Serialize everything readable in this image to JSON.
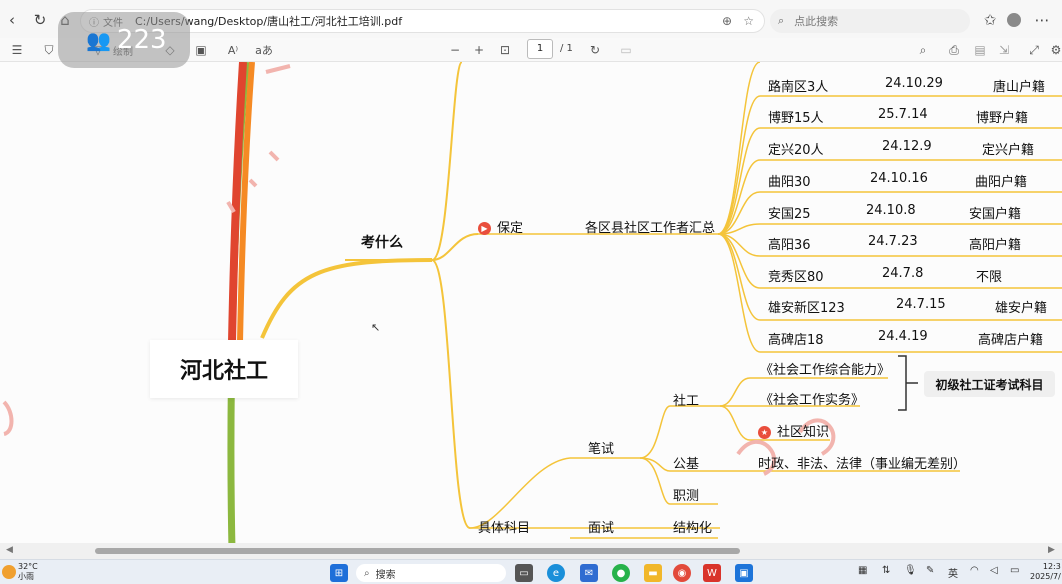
{
  "browser": {
    "file_label": "文件",
    "url": "C:/Users/wang/Desktop/唐山社工/河北社工培训.pdf",
    "search_placeholder": "点此搜索"
  },
  "pdf_toolbar": {
    "draw_label": "绘制",
    "page_current": "1",
    "page_total": "/ 1"
  },
  "overlay_badge": {
    "count": "223"
  },
  "mindmap": {
    "root": "河北社工",
    "branch_what": "考什么",
    "baoding": "保定",
    "summary": "各区县社区工作者汇总",
    "rows": [
      {
        "name": "路南区3人",
        "date": "24.10.29",
        "req": "唐山户籍"
      },
      {
        "name": "博野15人",
        "date": "25.7.14",
        "req": "博野户籍"
      },
      {
        "name": "定兴20人",
        "date": "24.12.9",
        "req": "定兴户籍"
      },
      {
        "name": "曲阳30",
        "date": "24.10.16",
        "req": "曲阳户籍"
      },
      {
        "name": "安国25",
        "date": "24.10.8",
        "req": "安国户籍"
      },
      {
        "name": "高阳36",
        "date": "24.7.23",
        "req": "高阳户籍"
      },
      {
        "name": "竞秀区80",
        "date": "24.7.8",
        "req": "不限"
      },
      {
        "name": "雄安新区123",
        "date": "24.7.15",
        "req": "雄安户籍"
      },
      {
        "name": "高碑店18",
        "date": "24.4.19",
        "req": "高碑店户籍"
      }
    ],
    "subjects": "具体科目",
    "written": "笔试",
    "social_work": "社工",
    "book1": "《社会工作综合能力》",
    "book2": "《社会工作实务》",
    "community": "社区知识",
    "exam_tag": "初级社工证考试科目",
    "gongji": "公基",
    "gongji_detail": "时政、非法、法律（事业编无差别）",
    "zhice": "职测",
    "interview": "面试",
    "structured": "结构化"
  },
  "taskbar": {
    "temp": "32°C",
    "weather": "小雨",
    "search": "搜索",
    "lang": "英",
    "time": "12:3",
    "date": "2025/7/"
  },
  "colors": {
    "branch_orange": "#f5a623",
    "branch_yellow": "#f4c43a",
    "spine_red": "#e0452f",
    "spine_orange": "#f58a24",
    "spine_green": "#8cb83f"
  }
}
